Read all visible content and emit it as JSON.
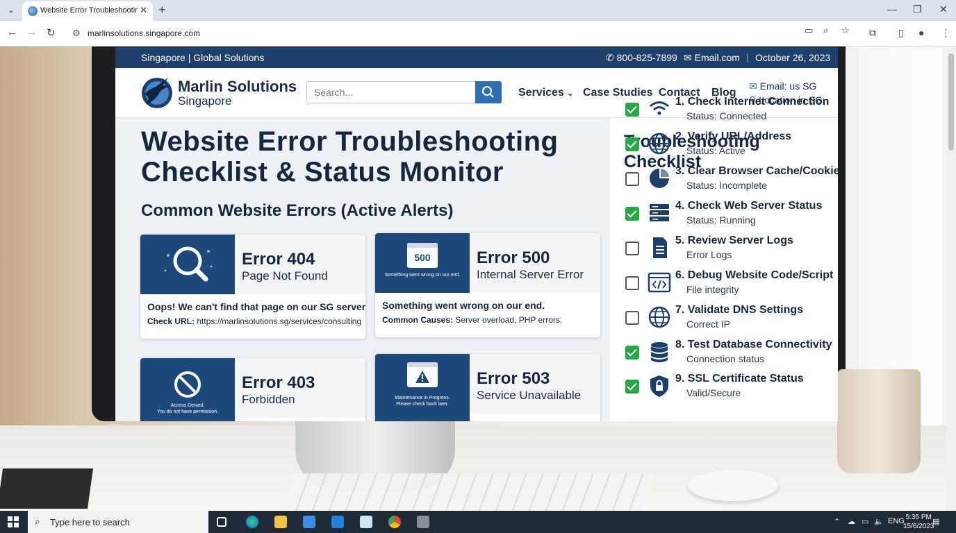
{
  "browser": {
    "tab_title": "Website Error Troubleshooting",
    "url": "marlinsolutions.singapore.com"
  },
  "site": {
    "topbar": {
      "location": "Singapore | Global Solutions",
      "phone": "800-825-7899",
      "email": "Email.com",
      "date": "October 26, 2023"
    },
    "brand": {
      "name": "Marlin Solutions",
      "sub": "Singapore"
    },
    "search": {
      "placeholder": "Search..."
    },
    "nav": [
      "Services",
      "Case Studies",
      "Contact",
      "Blog"
    ],
    "header_contact": {
      "email": "Email: us SG",
      "location": "Location in SG"
    },
    "page_title": "Website Error Troubleshooting Checklist & Status Monitor",
    "section_title": "Common Website Errors (Active Alerts)",
    "errors": [
      {
        "code": "Error 404",
        "desc": "Page Not Found",
        "line1": "Oops! We can't find that page on our SG server.",
        "line2_label": "Check URL:",
        "line2_value": "https://marlinsolutions.sg/services/consulting"
      },
      {
        "code": "Error 500",
        "desc": "Internal Server Error",
        "art_number": "500",
        "art_caption": "Something went wrong on our end.",
        "line1": "Something went wrong on our end.",
        "line2_label": "Common Causes:",
        "line2_value": "Server overload, PHP errors."
      },
      {
        "code": "Error 403",
        "desc": "Forbidden",
        "art_caption1": "Access Denied.",
        "art_caption2": "You do not have permission."
      },
      {
        "code": "Error 503",
        "desc": "Service Unavailable",
        "art_caption1": "Maintenance in Progress.",
        "art_caption2": "Please check back later."
      }
    ],
    "checklist": {
      "title": "Troubleshooting Checklist",
      "items": [
        {
          "name": "1. Check Internet Connection",
          "status": "Status: Connected",
          "checked": true,
          "icon": "wifi-icon"
        },
        {
          "name": "2. Verify URL/Address",
          "status": "Status: Active",
          "checked": true,
          "icon": "globe-icon"
        },
        {
          "name": "3. Clear Browser Cache/Cookies",
          "status": "Status: Incomplete",
          "checked": false,
          "icon": "pie-icon"
        },
        {
          "name": "4. Check Web Server Status",
          "status": "Status: Running",
          "checked": true,
          "icon": "server-icon"
        },
        {
          "name": "5. Review Server Logs",
          "status": "Error Logs",
          "checked": false,
          "icon": "document-icon"
        },
        {
          "name": "6. Debug Website Code/Script",
          "status": "File integrity",
          "checked": false,
          "icon": "code-icon"
        },
        {
          "name": "7. Validate DNS Settings",
          "status": "Correct IP",
          "checked": false,
          "icon": "globe-icon"
        },
        {
          "name": "8. Test Database Connectivity",
          "status": "Connection status",
          "checked": true,
          "icon": "database-icon"
        },
        {
          "name": "9. SSL Certificate Status",
          "status": "Valid/Secure",
          "checked": true,
          "icon": "shield-lock-icon"
        }
      ]
    }
  },
  "taskbar": {
    "search_placeholder": "Type here to search",
    "time": "5:35 PM",
    "date": "15/6/2023"
  },
  "colors": {
    "brand_navy": "#1e3f6b",
    "accent_blue": "#2f6eb1",
    "check_green": "#28a745"
  }
}
